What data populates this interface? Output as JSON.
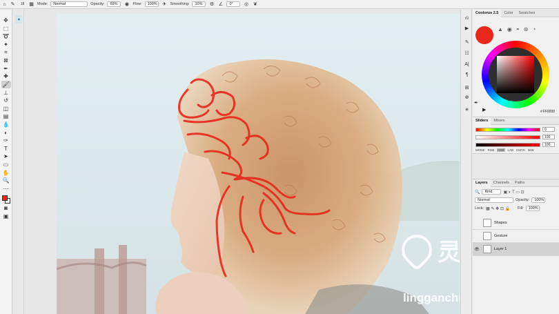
{
  "options_bar": {
    "mode_label": "Mode:",
    "mode_value": "Normal",
    "opacity_label": "Opacity:",
    "opacity_value": "69%",
    "flow_label": "Flow:",
    "flow_value": "100%",
    "smoothing_label": "Smoothing:",
    "smoothing_value": "10%",
    "angle_value": "0°",
    "brush_size": "18"
  },
  "toolbar": {
    "foreground_color": "#e8261a",
    "background_color": "#ffffff",
    "tools": [
      "move",
      "marquee",
      "lasso",
      "magic-wand",
      "crop",
      "frame",
      "eyedropper",
      "healing",
      "brush",
      "clone-stamp",
      "history-brush",
      "eraser",
      "gradient",
      "blur",
      "dodge",
      "pen",
      "type",
      "path-selection",
      "rectangle",
      "hand",
      "zoom",
      "more"
    ]
  },
  "color_panel": {
    "tabs": [
      "Coolorus 2.5",
      "Color",
      "Swatches"
    ],
    "active_tab": "Coolorus 2.5",
    "current_color": "#e8261a",
    "hex_label": "#",
    "hex_value": "FF0000"
  },
  "sliders_panel": {
    "tabs": [
      "Sliders",
      "Mixers"
    ],
    "active_tab": "Sliders",
    "values": [
      "0",
      "100",
      "100"
    ],
    "mode_label": "MODE",
    "modes": [
      "RGB",
      "HSB",
      "LAB",
      "CMYK",
      "B/W"
    ],
    "active_mode": "HSB"
  },
  "layers_panel": {
    "tabs": [
      "Layers",
      "Channels",
      "Paths"
    ],
    "active_tab": "Layers",
    "filter_value": "Kind",
    "blend_mode": "Normal",
    "opacity_label": "Opacity:",
    "opacity_value": "100%",
    "lock_label": "Lock:",
    "fill_label": "Fill:",
    "fill_value": "100%",
    "layers": [
      {
        "name": "Shapes",
        "visible": false,
        "selected": false
      },
      {
        "name": "Gesture",
        "visible": false,
        "selected": false
      },
      {
        "name": "Layer 1",
        "visible": true,
        "selected": true
      }
    ]
  },
  "watermark": {
    "text": "灵感中国",
    "url": "lingganchina.com"
  },
  "colors": {
    "stroke_red": "#e8261a",
    "panel_bg": "#f0f0f0",
    "accent": "#e8261a"
  }
}
